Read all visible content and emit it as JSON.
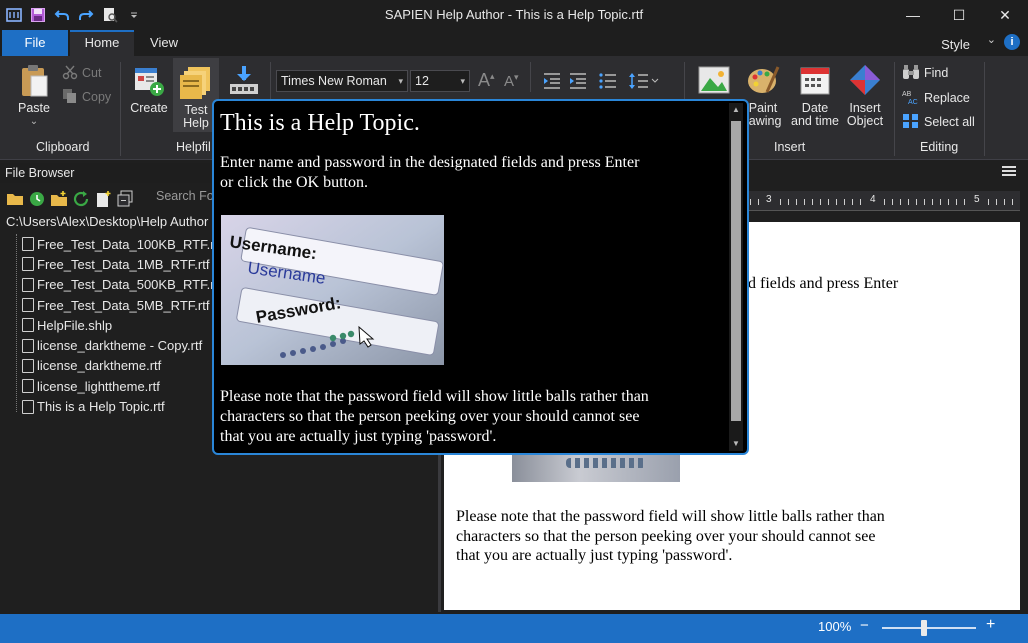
{
  "window": {
    "title": "SAPIEN Help Author - This is a Help Topic.rtf",
    "controls": {
      "minimize": "—",
      "maximize": "☐",
      "close": "✕"
    }
  },
  "ribbon_tabs": [
    {
      "label": "File"
    },
    {
      "label": "Home"
    },
    {
      "label": "View"
    }
  ],
  "style_menu": {
    "label": "Style",
    "chevron": "⌄",
    "help": "i"
  },
  "ribbon": {
    "clipboard": {
      "label": "Clipboard",
      "paste": "Paste",
      "paste_arrow": "⌄",
      "cut": "Cut",
      "copy": "Copy"
    },
    "helpfile": {
      "label": "Helpfil",
      "create": "Create",
      "test_help_line1": "Test",
      "test_help_line2": "Help"
    },
    "font": {
      "family": "Times New Roman",
      "size": "12",
      "dd": "▾"
    },
    "insert": {
      "label": "Insert",
      "paint_line1": "Paint",
      "paint_line2": "rawing",
      "date_line1": "Date",
      "date_line2": "and time",
      "object_line1": "Insert",
      "object_line2": "Object"
    },
    "editing": {
      "label": "Editing",
      "find": "Find",
      "replace": "Replace",
      "select_all": "Select all"
    }
  },
  "file_browser": {
    "header": "File Browser",
    "search_placeholder": "Search Fo",
    "path": "C:\\Users\\Alex\\Desktop\\Help Author",
    "files": [
      "Free_Test_Data_100KB_RTF.rtf",
      "Free_Test_Data_1MB_RTF.rtf",
      "Free_Test_Data_500KB_RTF.rtf",
      "Free_Test_Data_5MB_RTF.rtf",
      "HelpFile.shlp",
      "license_darktheme - Copy.rtf",
      "license_darktheme.rtf",
      "license_lighttheme.rtf",
      "This is a Help Topic.rtf"
    ]
  },
  "ruler": {
    "n3": "3",
    "n4": "4",
    "n5": "5"
  },
  "editor": {
    "line1": "d fields and press Enter",
    "para2_line1": "Please note that the password field will show little balls rather than",
    "para2_line2": "characters so that the person peeking over your should cannot see",
    "para2_line3": "that you are actually just typing 'password'."
  },
  "preview": {
    "title": "This is a Help Topic.",
    "para1_line1": "Enter name and password in the designated fields and press Enter",
    "para1_line2": "or click the OK button.",
    "image_username_label": "Username:",
    "image_username_value": "Username",
    "image_password_label": "Password:",
    "para2_line1": "Please note that the password field will show little balls rather than",
    "para2_line2": "characters so that the person peeking over your should cannot see",
    "para2_line3": "that you are actually just typing 'password'."
  },
  "status": {
    "zoom": "100%",
    "zoom_out": "−",
    "zoom_in": "+",
    "zoom_level": 0.45
  },
  "colors": {
    "accent": "#1e6fc5",
    "popup_border": "#2a86d8"
  }
}
